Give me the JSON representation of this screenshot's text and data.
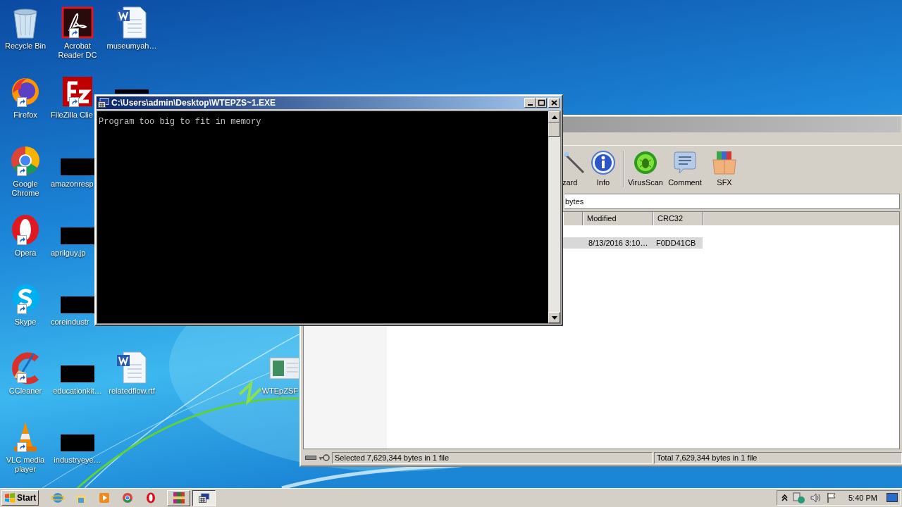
{
  "desktop_icons": [
    {
      "label": "Recycle Bin",
      "kind": "recycle",
      "shortcut": false
    },
    {
      "label": "Firefox",
      "kind": "firefox",
      "shortcut": true
    },
    {
      "label": "Google Chrome",
      "kind": "chrome",
      "shortcut": true
    },
    {
      "label": "Opera",
      "kind": "opera",
      "shortcut": true
    },
    {
      "label": "Skype",
      "kind": "skype",
      "shortcut": true
    },
    {
      "label": "CCleaner",
      "kind": "ccleaner",
      "shortcut": true
    },
    {
      "label": "VLC media player",
      "kind": "vlc",
      "shortcut": true
    },
    {
      "label": "Acrobat Reader DC",
      "kind": "acrobat",
      "shortcut": true
    },
    {
      "label": "FileZilla Clie",
      "kind": "filezilla",
      "shortcut": true
    },
    {
      "label": "amazonresp",
      "kind": "thumbnail",
      "shortcut": false
    },
    {
      "label": "aprilguy.jp",
      "kind": "thumbnail",
      "shortcut": false
    },
    {
      "label": "coreindustr",
      "kind": "thumbnail",
      "shortcut": false
    },
    {
      "label": "educationkit…",
      "kind": "thumbnail",
      "shortcut": false
    },
    {
      "label": "industryeye…",
      "kind": "thumbnail",
      "shortcut": false
    },
    {
      "label": "museumyah…",
      "kind": "word",
      "shortcut": false
    },
    {
      "kind": "thumbnail",
      "shortcut": false
    },
    {
      "label": "relatedflow.rtf",
      "kind": "word",
      "shortcut": false
    },
    {
      "label": "WTEpZSF",
      "kind": "program",
      "shortcut": false
    }
  ],
  "archive_window": {
    "toolbar": [
      {
        "label": "zard",
        "kind": "wizard"
      },
      {
        "label": "Info",
        "kind": "info"
      },
      {
        "label": "VirusScan",
        "kind": "virusscan"
      },
      {
        "label": "Comment",
        "kind": "comment"
      },
      {
        "label": "SFX",
        "kind": "sfx"
      }
    ],
    "address": "bytes",
    "columns": [
      "Modified",
      "CRC32"
    ],
    "rows": [
      {
        "cells": [
          "8/13/2016 3:10…",
          "F0DD41CB"
        ],
        "selected": true
      }
    ],
    "status_left": "Selected 7,629,344 bytes in 1 file",
    "status_right": "Total 7,629,344 bytes in 1 file"
  },
  "console_window": {
    "title": "C:\\Users\\admin\\Desktop\\WTEPZS~1.EXE",
    "output": "Program too big to fit in memory"
  },
  "taskbar": {
    "start": "Start",
    "task_buttons": [
      {
        "kind": "winrar",
        "selected": false
      },
      {
        "kind": "console",
        "selected": true
      }
    ],
    "clock": "5:40 PM"
  }
}
